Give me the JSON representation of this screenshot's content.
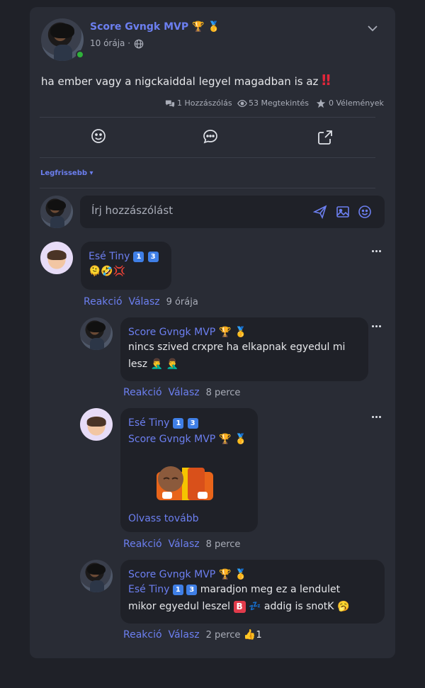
{
  "post": {
    "author": "Score Gvngk MVP",
    "author_badges": "🏆 🥇",
    "time": "10 órája",
    "time_sep": "·",
    "text": "ha ember vagy a nigckaiddal legyel magadban is az",
    "text_emoji": "‼",
    "stats": {
      "comments": "1 Hozzászólás",
      "views": "53 Megtekintés",
      "reviews": "0 Vélemények"
    }
  },
  "sort": {
    "label": "Legfrissebb"
  },
  "composer": {
    "placeholder": "Írj hozzászólást"
  },
  "comments": [
    {
      "author": "Esé Tiny",
      "badges": [
        "1",
        "3"
      ],
      "text": "🫠🤣💢",
      "react": "Reakció",
      "reply": "Válasz",
      "time": "9 órája"
    },
    {
      "author": "Score Gvngk MVP",
      "author_badges": "🏆 🥇",
      "text": "nincs szived crxpre ha elkapnak egyedul mi lesz 🤦‍♂️ 🤦‍♂️",
      "react": "Reakció",
      "reply": "Válasz",
      "time": "8 perce"
    },
    {
      "author": "Esé Tiny",
      "badges": [
        "1",
        "3"
      ],
      "mention": "Score Gvngk MVP",
      "mention_badges": "🏆 🥇",
      "read_more": "Olvass tovább",
      "react": "Reakció",
      "reply": "Válasz",
      "time": "8 perce"
    },
    {
      "author": "Score Gvngk MVP",
      "author_badges": "🏆 🥇",
      "mention": "Esé Tiny",
      "mention_badges": [
        "1",
        "3"
      ],
      "text_1": "maradjon meg ez a lendulet",
      "text_2": "mikor egyedul leszel",
      "b_badge": "B",
      "zzz": "💤",
      "text_3": "addig is snotK",
      "text_emoji": "🥱",
      "react": "Reakció",
      "reply": "Válasz",
      "time": "2 perce",
      "like_count": "1"
    }
  ],
  "colors": {
    "background": "#1f2128",
    "card": "#292c35",
    "accent": "#6c7ff0",
    "muted": "#a9adb8",
    "online": "#2fb13a"
  },
  "icons": [
    "chevron-down-icon",
    "globe-icon",
    "comments-icon",
    "eye-icon",
    "star-icon",
    "smiley-icon",
    "chat-bubble-icon",
    "share-icon",
    "send-icon",
    "image-icon",
    "emoji-icon",
    "more-icon",
    "thumbs-up-icon"
  ]
}
